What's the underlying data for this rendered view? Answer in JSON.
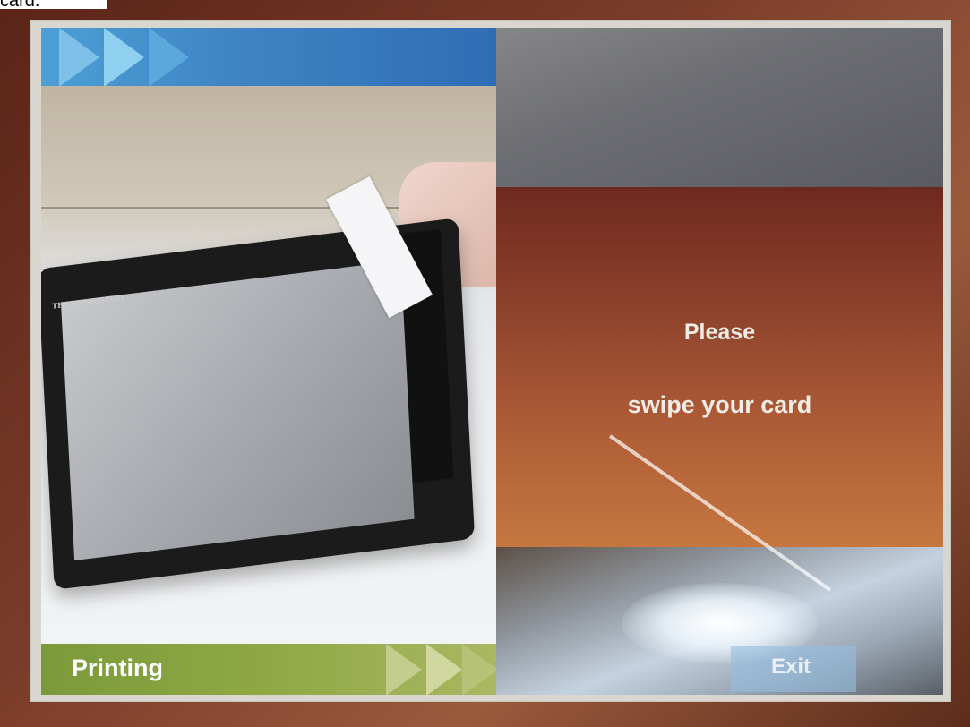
{
  "caption": "card.",
  "left_panel": {
    "device_label": "TFT LCD DISPLAY",
    "footer_label": "Printing"
  },
  "right_panel": {
    "message_line1": "Please",
    "message_line2": "swipe your card",
    "exit_label": "Exit"
  },
  "colors": {
    "top_banner": "#3f86c5",
    "bottom_banner": "#8fa844",
    "message_panel": "#8a3f2a",
    "message_text": "#f0ece6"
  }
}
